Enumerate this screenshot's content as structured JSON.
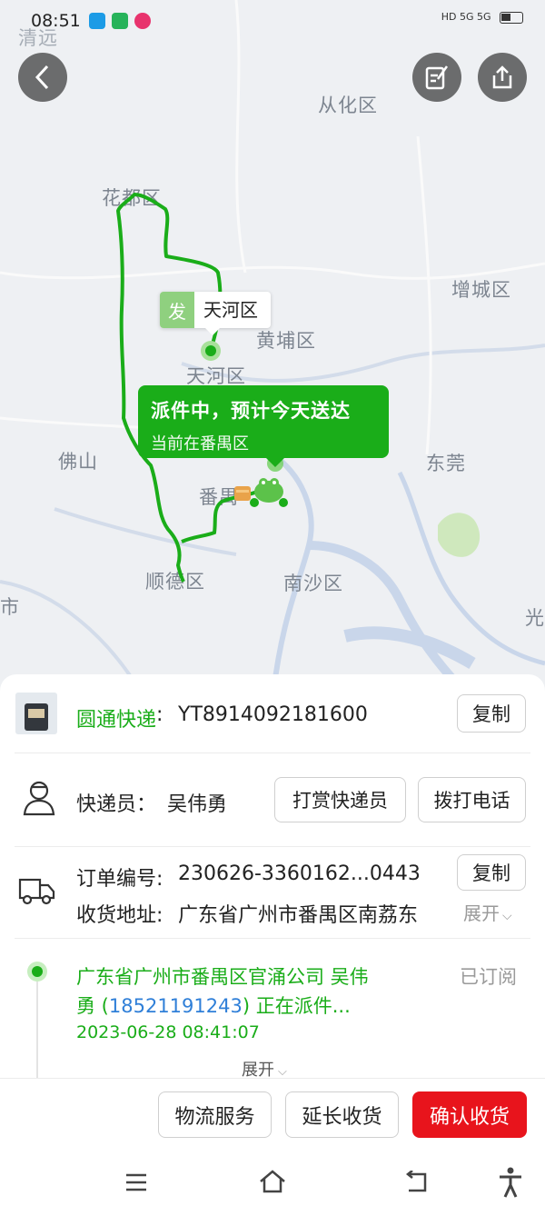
{
  "status_bar": {
    "time": "08:51",
    "signal": "HD 5G 5G"
  },
  "map": {
    "places": {
      "qingyuan": "清远",
      "conghua": "从化区",
      "huadu": "花都区",
      "zengcheng": "增城区",
      "huangpu": "黄埔区",
      "tianhe": "天河区",
      "foshan": "佛山",
      "dongguan": "东莞",
      "panyu": "番禺",
      "shunde": "顺德区",
      "nansha": "南沙区",
      "shi": "市",
      "guang": "光"
    },
    "origin_tag": {
      "badge": "发",
      "name": "天河区"
    },
    "status_bubble": {
      "headline": "派件中，预计今天送达",
      "subtext": "当前在番禺区"
    },
    "route_color": "#1aad19"
  },
  "express": {
    "company": "圆通快递",
    "separator": ":",
    "tracking_no": "YT8914092181600",
    "copy_label": "复制"
  },
  "courier": {
    "label": "快递员：",
    "name": "吴伟勇",
    "tip_label": "打赏快递员",
    "call_label": "拨打电话"
  },
  "order": {
    "order_label": "订单编号:",
    "order_no": "230626-3360162...0443",
    "copy_label": "复制",
    "address_label": "收货地址:",
    "address": "广东省广州市番禺区南荔东",
    "expand_label": "展开"
  },
  "tracking": {
    "line1_prefix": "广东省广州市番禺区官涌公司 吴伟",
    "line2_prefix": "勇 (",
    "phone": "18521191243",
    "line2_suffix": ") 正在派件...",
    "time": "2023-06-28  08:41:07",
    "subscribed": "已订阅",
    "expand_label": "展开"
  },
  "actions": {
    "logistics": "物流服务",
    "extend": "延长收货",
    "confirm": "确认收货"
  },
  "icons": {
    "back": "back-icon",
    "edit": "edit-icon",
    "share": "share-icon",
    "person": "person-icon",
    "truck": "truck-icon",
    "menu": "menu-icon",
    "home": "home-icon",
    "back_nav": "back-nav-icon",
    "accessibility": "accessibility-icon"
  },
  "colors": {
    "accent_green": "#1aad19",
    "confirm_red": "#e8141c",
    "link_blue": "#2f7fd8"
  }
}
